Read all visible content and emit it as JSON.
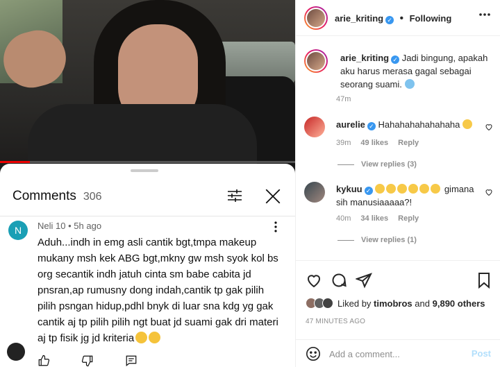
{
  "video": {
    "progress": 0.1
  },
  "comments_sheet": {
    "title": "Comments",
    "count": "306",
    "comment": {
      "avatar_letter": "N",
      "author": "Neli 10",
      "separator": "•",
      "age": "5h ago",
      "text": "Aduh...indh in emg asli cantik bgt,tmpa makeup mukany msh kek ABG bgt,mkny gw msh syok kol bs org secantik indh jatuh cinta sm babe cabita jd pnsran,ap rumusny dong indah,cantik tp gak pilih pilih psngan hidup,pdhl bnyk di luar sna kdg yg gak cantik aj tp pilih pilih ngt buat jd suami gak dri materi aj tp fisik jg jd kriteria"
    }
  },
  "instagram": {
    "header": {
      "username": "arie_kriting",
      "separator": "•",
      "follow_status": "Following"
    },
    "caption": {
      "username": "arie_kriting",
      "text": "Jadi bingung, apakah aku harus merasa gagal sebagai seorang suami.",
      "age": "47m"
    },
    "comments": [
      {
        "username": "aurelie",
        "text": "Hahahahahahahaha",
        "age": "39m",
        "likes": "49 likes",
        "reply_label": "Reply",
        "view_replies": "View replies (3)"
      },
      {
        "username": "kykuu",
        "text": "gimana sih manusiaaaaa?!",
        "age": "40m",
        "likes": "34 likes",
        "reply_label": "Reply",
        "view_replies": "View replies (1)"
      }
    ],
    "likes": {
      "prefix": "Liked by",
      "user": "timobros",
      "and": "and",
      "others": "9,890 others"
    },
    "timestamp": "47 MINUTES AGO",
    "add_comment_placeholder": "Add a comment...",
    "post_label": "Post"
  },
  "icons": [
    "filter-icon",
    "close-icon",
    "more-vert-icon",
    "like-icon",
    "dislike-icon",
    "reply-icon",
    "more-horizontal-icon",
    "heart-icon",
    "comment-icon",
    "share-icon",
    "bookmark-icon",
    "smile-icon",
    "verified-icon"
  ],
  "colors": {
    "youtube_red": "#ff0000",
    "ig_verified": "#3897f0",
    "ig_post_disabled": "#b2dffc",
    "avatar_teal": "#1a9fb5"
  }
}
